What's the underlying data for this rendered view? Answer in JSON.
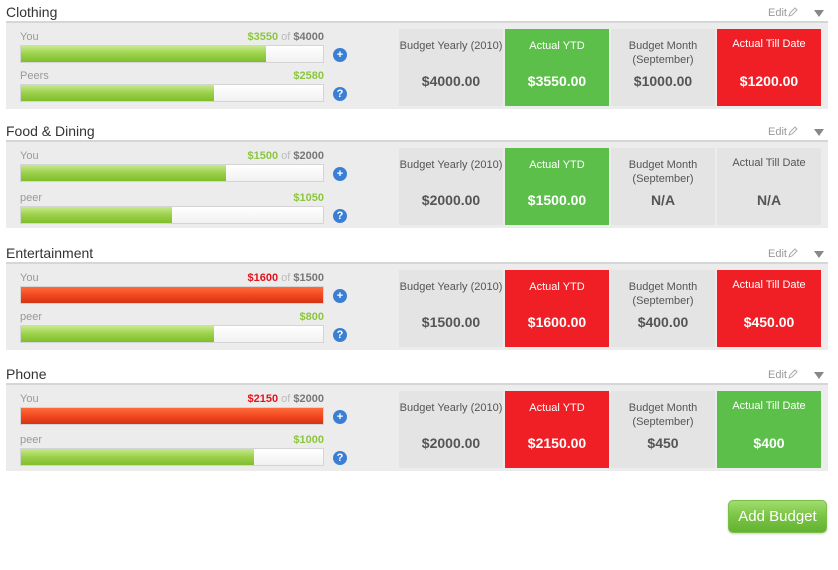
{
  "edit_label": "Edit",
  "add_budget_label": "Add Budget",
  "colors": {
    "green": "#5cbf4a",
    "red": "#ef1f25",
    "grey": "#e4e4e4",
    "blue": "#3a7fd4"
  },
  "categories": [
    {
      "name": "Clothing",
      "you": {
        "label": "You",
        "amount": "$3550",
        "of": "of",
        "target": "$4000",
        "fill_pct": 81,
        "status": "green"
      },
      "peer": {
        "label": "Peers",
        "amount": "$2580",
        "fill_pct": 64
      },
      "boxes": [
        {
          "label": "Budget Yearly (2010)",
          "value": "$4000.00",
          "color": "grey"
        },
        {
          "label": "Actual YTD",
          "value": "$3550.00",
          "color": "green"
        },
        {
          "label": "Budget Month (September)",
          "value": "$1000.00",
          "color": "grey"
        },
        {
          "label": "Actual Till Date",
          "value": "$1200.00",
          "color": "red"
        }
      ]
    },
    {
      "name": "Food & Dining",
      "you": {
        "label": "You",
        "amount": "$1500",
        "of": "of",
        "target": "$2000",
        "fill_pct": 68,
        "status": "green"
      },
      "peer": {
        "label": "peer",
        "amount": "$1050",
        "fill_pct": 50
      },
      "boxes": [
        {
          "label": "Budget Yearly (2010)",
          "value": "$2000.00",
          "color": "grey"
        },
        {
          "label": "Actual YTD",
          "value": "$1500.00",
          "color": "green"
        },
        {
          "label": "Budget Month (September)",
          "value": "N/A",
          "color": "grey"
        },
        {
          "label": "Actual Till Date",
          "value": "N/A",
          "color": "grey"
        }
      ]
    },
    {
      "name": "Entertainment",
      "you": {
        "label": "You",
        "amount": "$1600",
        "of": "of",
        "target": "$1500",
        "fill_pct": 100,
        "status": "red"
      },
      "peer": {
        "label": "peer",
        "amount": "$800",
        "fill_pct": 64
      },
      "boxes": [
        {
          "label": "Budget Yearly (2010)",
          "value": "$1500.00",
          "color": "grey"
        },
        {
          "label": "Actual YTD",
          "value": "$1600.00",
          "color": "red"
        },
        {
          "label": "Budget Month (September)",
          "value": "$400.00",
          "color": "grey"
        },
        {
          "label": "Actual Till Date",
          "value": "$450.00",
          "color": "red"
        }
      ]
    },
    {
      "name": "Phone",
      "you": {
        "label": "You",
        "amount": "$2150",
        "of": "of",
        "target": "$2000",
        "fill_pct": 100,
        "status": "red"
      },
      "peer": {
        "label": "peer",
        "amount": "$1000",
        "fill_pct": 77
      },
      "boxes": [
        {
          "label": "Budget Yearly (2010)",
          "value": "$2000.00",
          "color": "grey"
        },
        {
          "label": "Actual YTD",
          "value": "$2150.00",
          "color": "red"
        },
        {
          "label": "Budget Month (September)",
          "value": "$450",
          "color": "grey"
        },
        {
          "label": "Actual Till Date",
          "value": "$400",
          "color": "green"
        }
      ]
    }
  ]
}
